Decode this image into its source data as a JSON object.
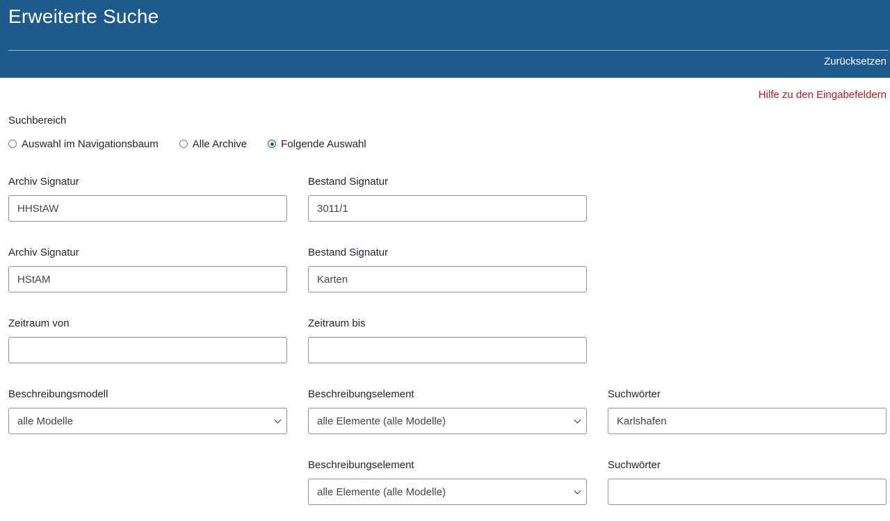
{
  "header": {
    "title": "Erweiterte Suche",
    "reset_label": "Zurücksetzen"
  },
  "help_label": "Hilfe zu den Eingabefeldern",
  "search_area": {
    "label": "Suchbereich",
    "options": [
      {
        "label": "Auswahl im Navigationsbaum",
        "checked": false
      },
      {
        "label": "Alle Archive",
        "checked": false
      },
      {
        "label": "Folgende Auswahl",
        "checked": true
      }
    ]
  },
  "rows": [
    {
      "archive_label": "Archiv Signatur",
      "archive_value": "HHStAW",
      "holding_label": "Bestand Signatur",
      "holding_value": "3011/1"
    },
    {
      "archive_label": "Archiv Signatur",
      "archive_value": "HStAM",
      "holding_label": "Bestand Signatur",
      "holding_value": "Karten"
    }
  ],
  "period": {
    "from_label": "Zeitraum von",
    "from_value": "",
    "to_label": "Zeitraum bis",
    "to_value": ""
  },
  "description": {
    "model_label": "Beschreibungsmodell",
    "model_value": "alle Modelle",
    "element_rows": [
      {
        "element_label": "Beschreibungselement",
        "element_value": "alle Elemente (alle Modelle)",
        "keywords_label": "Suchwörter",
        "keywords_value": "Karlshafen"
      },
      {
        "element_label": "Beschreibungselement",
        "element_value": "alle Elemente (alle Modelle)",
        "keywords_label": "Suchwörter",
        "keywords_value": ""
      }
    ]
  },
  "icons": {
    "select_chevron": "chevron-down-icon"
  },
  "colors": {
    "header_bg": "#1f5a8e",
    "help_link": "#b01d1d"
  }
}
